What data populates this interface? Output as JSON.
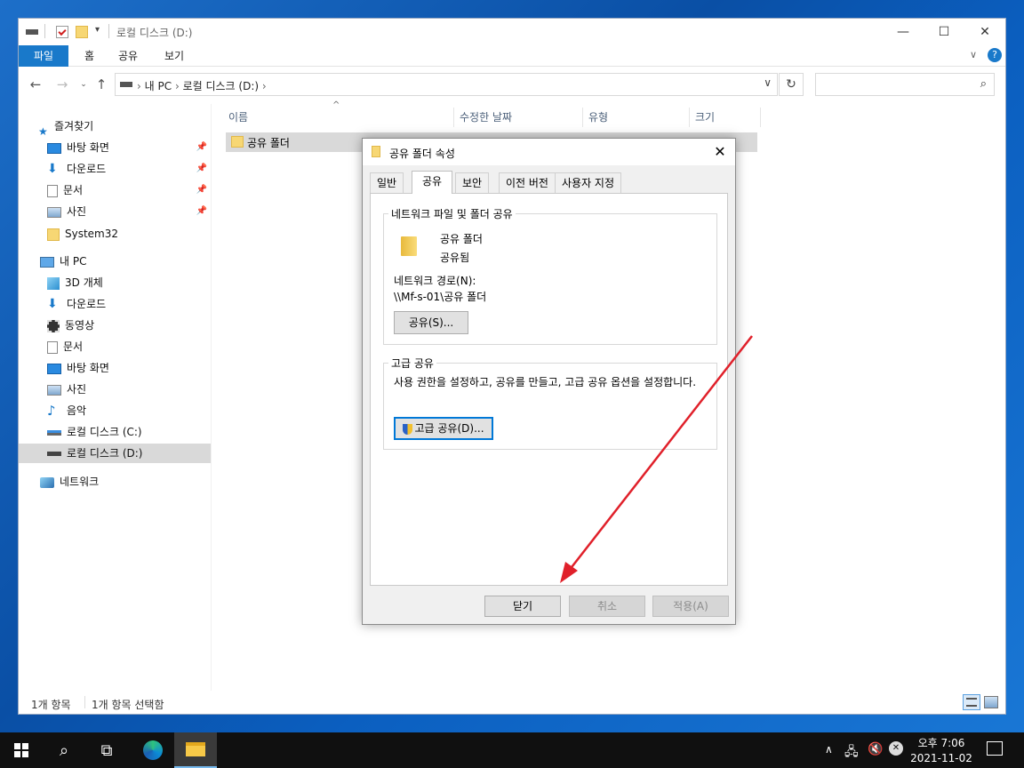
{
  "window": {
    "title": "로컬 디스크 (D:)",
    "min": "—",
    "max": "☐",
    "close": "✕"
  },
  "ribbon": {
    "tabs": [
      "파일",
      "홈",
      "공유",
      "보기"
    ]
  },
  "address": {
    "crumbs": [
      "내 PC",
      "로컬 디스크 (D:)"
    ]
  },
  "sidebar": {
    "items": [
      {
        "label": "즐겨찾기",
        "icon": "star-icon"
      },
      {
        "label": "바탕 화면",
        "icon": "desktop-icon",
        "pinned": true
      },
      {
        "label": "다운로드",
        "icon": "download-icon",
        "pinned": true
      },
      {
        "label": "문서",
        "icon": "document-icon",
        "pinned": true
      },
      {
        "label": "사진",
        "icon": "picture-icon",
        "pinned": true
      },
      {
        "label": "System32",
        "icon": "folder-icon"
      },
      {
        "label": "내 PC",
        "icon": "pc-icon"
      },
      {
        "label": "3D 개체",
        "icon": "cube-icon"
      },
      {
        "label": "다운로드",
        "icon": "download-icon"
      },
      {
        "label": "동영상",
        "icon": "video-icon"
      },
      {
        "label": "문서",
        "icon": "document-icon"
      },
      {
        "label": "바탕 화면",
        "icon": "desktop-icon"
      },
      {
        "label": "사진",
        "icon": "picture-icon"
      },
      {
        "label": "음악",
        "icon": "music-icon"
      },
      {
        "label": "로컬 디스크 (C:)",
        "icon": "drive-c-icon"
      },
      {
        "label": "로컬 디스크 (D:)",
        "icon": "drive-icon"
      },
      {
        "label": "네트워크",
        "icon": "network-icon"
      }
    ]
  },
  "columns": [
    "이름",
    "수정한 날짜",
    "유형",
    "크기"
  ],
  "files": [
    {
      "name": "공유 폴더"
    }
  ],
  "status": {
    "count": "1개 항목",
    "selected": "1개 항목 선택함"
  },
  "dialog": {
    "title": "공유 폴더 속성",
    "tabs": [
      "일반",
      "공유",
      "보안",
      "이전 버전",
      "사용자 지정"
    ],
    "network_group_title": "네트워크 파일 및 폴더 공유",
    "folder_name": "공유 폴더",
    "share_state": "공유됨",
    "network_path_label": "네트워크 경로(N):",
    "network_path": "\\\\Mf-s-01\\공유 폴더",
    "share_button": "공유(S)...",
    "advanced_group_title": "고급 공유",
    "advanced_desc": "사용 권한을 설정하고, 공유를 만들고, 고급 공유 옵션을 설정합니다.",
    "advanced_button": "고급 공유(D)...",
    "close_button": "닫기",
    "cancel_button": "취소",
    "apply_button": "적용(A)"
  },
  "taskbar": {
    "time": "오후 7:06",
    "date": "2021-11-02"
  },
  "colors": {
    "accent": "#0078d7",
    "file_tab": "#1979ca",
    "arrow": "#e0202a"
  }
}
